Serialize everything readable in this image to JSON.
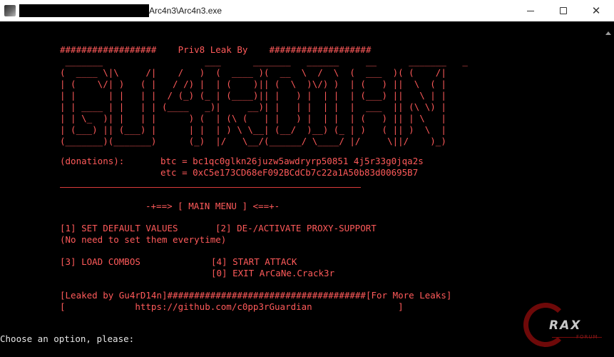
{
  "window": {
    "title": "Arc4n3\\Arc4n3.exe",
    "app_icon": "app-icon"
  },
  "controls": {
    "minimize": "minimize-icon",
    "maximize": "maximize-icon",
    "close": "close-icon",
    "close_glyph": "✕"
  },
  "console": {
    "header": "##################    Priv8 Leak By    ###################",
    "ascii_art": " _______                   ___      _______   ______     __      _______   _\n(  ____ \\|\\     /|    /   )  (  ____ )(  __  \\  /  \\  (  ___  )( (    /|\n| (    \\/| )   ( |   / /) |  | (    )|| (  \\  )\\/) )  | (   ) ||  \\  ( |\n| |      | |   | |  / (_) (_ | (____)|| |   ) |  | |  | (___) ||   \\ | |\n| | ____ | |   | | (____   _)|     __)| |   | |  | |  |  ___  || (\\ \\) |\n| | \\_  )| |   | |      ) (  | (\\ (   | |   ) |  | |  | (   ) || | \\   |\n| (___) || (___) |      | |  | ) \\ \\__| (__/  )__) (_ | )   ( || )  \\  |\n(_______)(_______)      (_)  |/   \\__/(______/ \\____/ |/     \\||/    )_)",
    "donations_label": "(donations):",
    "btc": "btc = bc1qc0glkn26juzw5awdryrp50851 4j5r33g0jqa2s",
    "eth": "etc = 0xC5e173CD68eF092BCdCb7c22a1A50b83d00695B7",
    "menu_title": "-+==> [ MAIN MENU ] <==+-",
    "option_1": "[1] SET DEFAULT VALUES",
    "option_2": "[2] DE-/ACTIVATE PROXY-SUPPORT",
    "option_1_note": "(No need to set them everytime)",
    "option_3": "[3] LOAD COMBOS",
    "option_4": "[4] START ATTACK",
    "option_0": "[0] EXIT ArCaNe.Crack3r",
    "leak_line": "[Leaked by Gu4rD14n]#####################################[For More Leaks]",
    "github_line": "[             https://github.com/c0pp3rGuardian                ]",
    "prompt": "Choose an option, please:"
  },
  "watermark": {
    "text": "RAX",
    "sub": "FORUM"
  },
  "colors": {
    "console_text": "#ff5a5a",
    "background": "#000000",
    "prompt_text": "#e6e6e6"
  }
}
